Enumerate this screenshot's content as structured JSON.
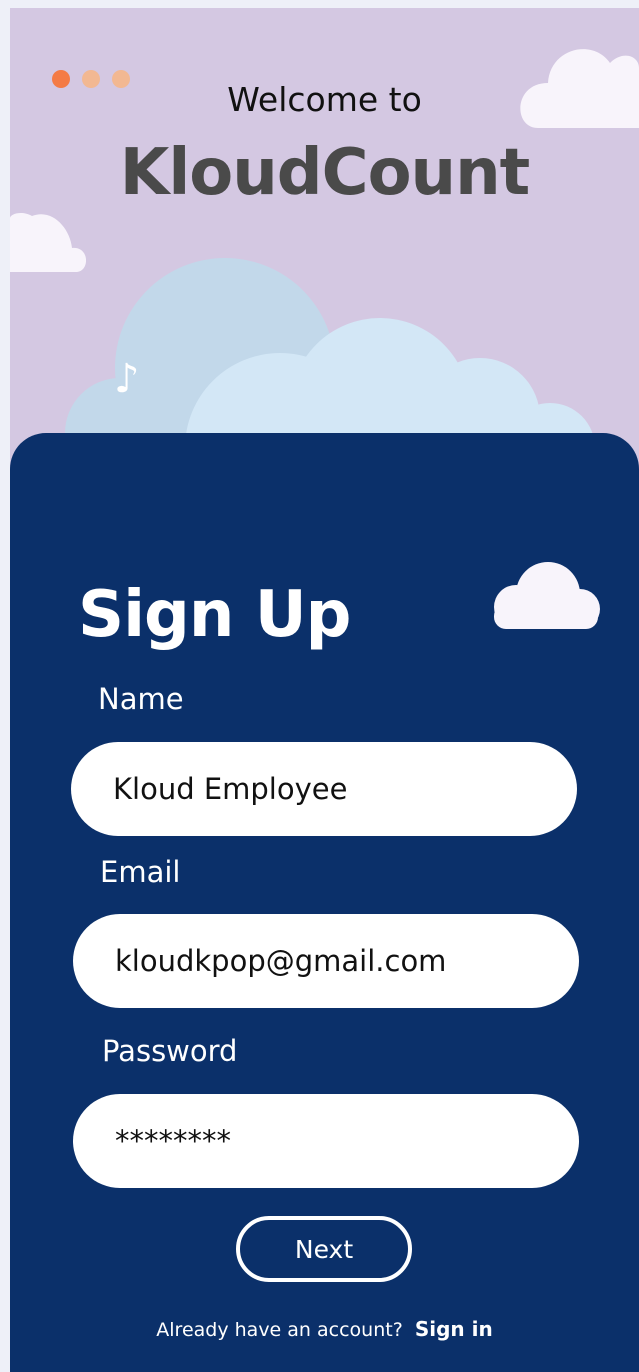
{
  "header": {
    "welcome_text": "Welcome to",
    "brand_name": "KloudCount"
  },
  "window_controls": {
    "colors": [
      "#f47b45",
      "#f2b892",
      "#f2b892"
    ]
  },
  "decoration": {
    "music_note": "♪",
    "icons": [
      "cloud-icon",
      "music-note-icon"
    ]
  },
  "form": {
    "title": "Sign Up",
    "fields": {
      "name": {
        "label": "Name",
        "value": "Kloud Employee"
      },
      "email": {
        "label": "Email",
        "value": "kloudkpop@gmail.com"
      },
      "password": {
        "label": "Password",
        "value": "********"
      }
    },
    "next_label": "Next",
    "signin_prompt": "Already have an account?",
    "signin_link": "Sign in"
  },
  "colors": {
    "background": "#d4c8e2",
    "card": "#0b306a",
    "field": "#ffffff",
    "cloud_light": "#f8f4fb",
    "cloud_blue": "#cde4f4"
  }
}
